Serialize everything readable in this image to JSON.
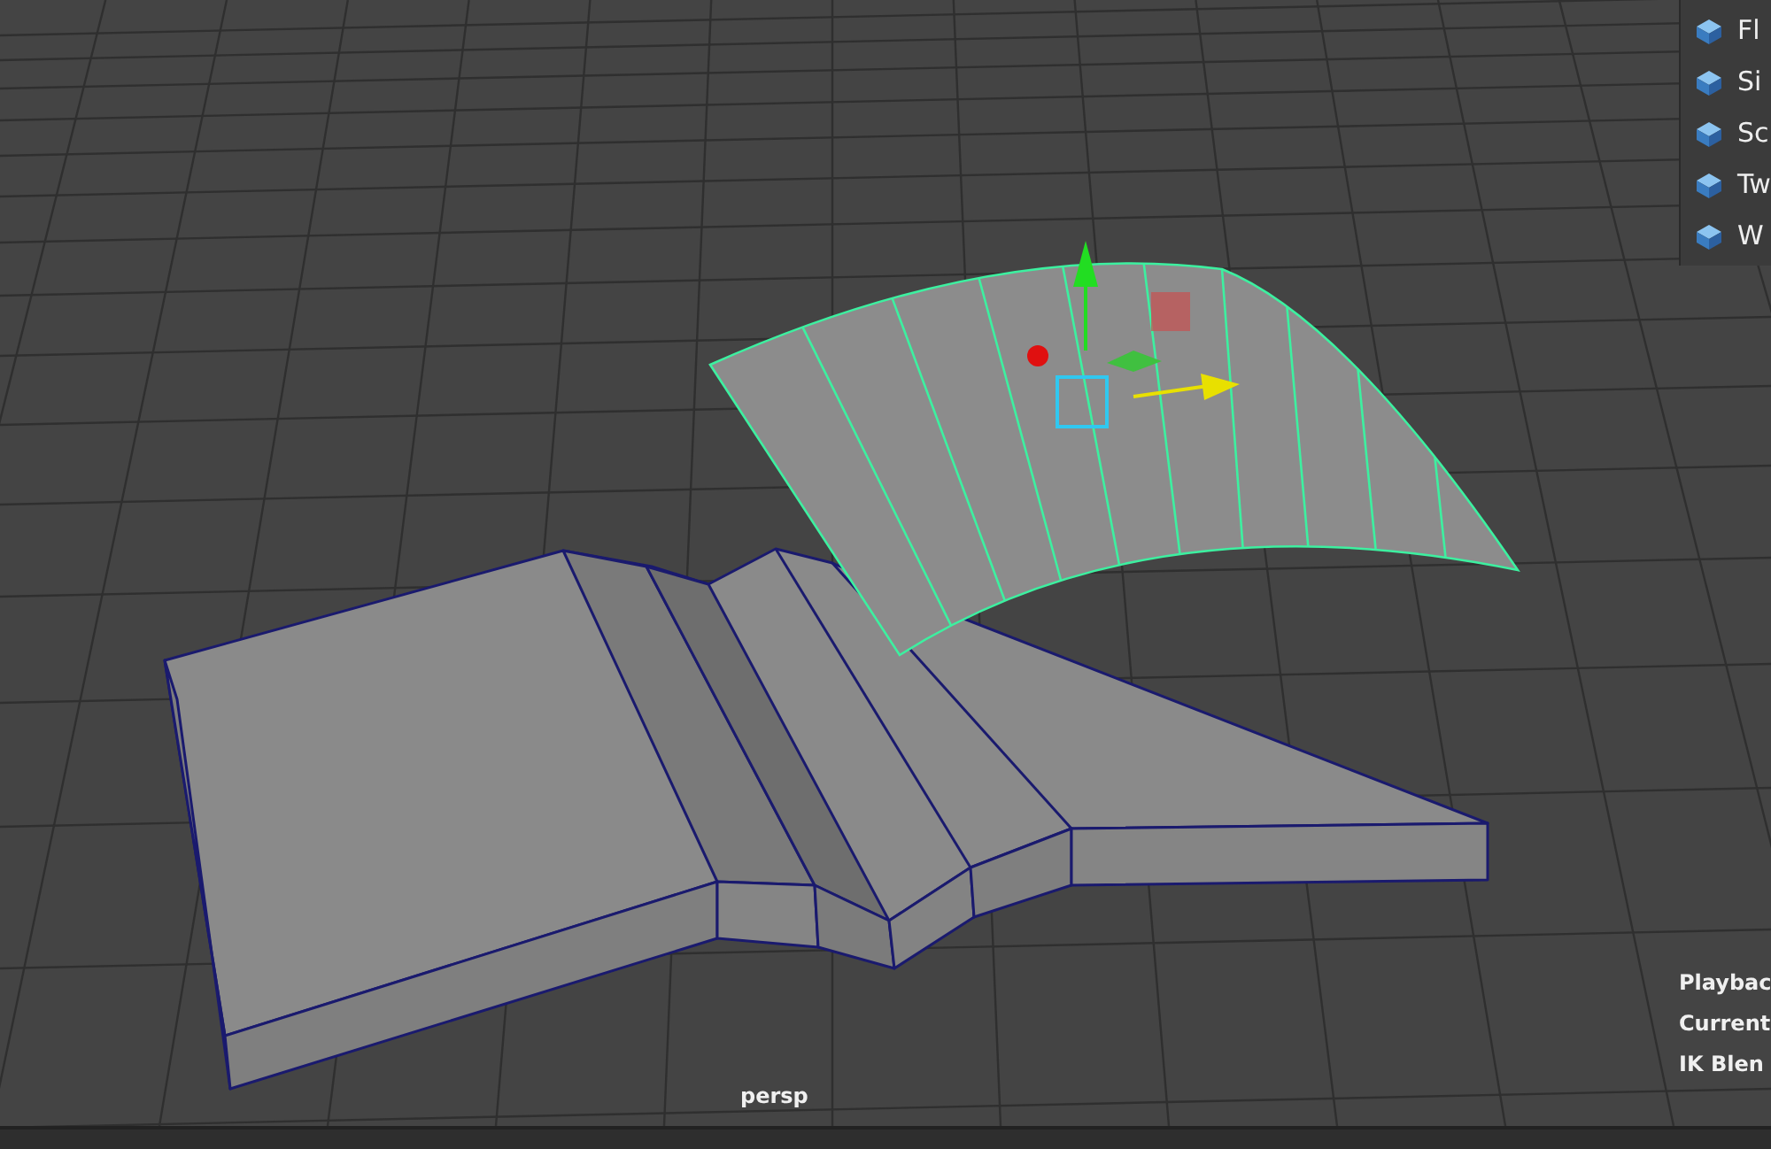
{
  "menu": {
    "items": [
      {
        "label": "Fl"
      },
      {
        "label": "Si"
      },
      {
        "label": "Sc"
      },
      {
        "label": "Tw"
      },
      {
        "label": "W"
      }
    ]
  },
  "viewport": {
    "camera_label": "persp"
  },
  "hud": {
    "lines": [
      "Playbac",
      "Current",
      "IK Blen"
    ]
  }
}
